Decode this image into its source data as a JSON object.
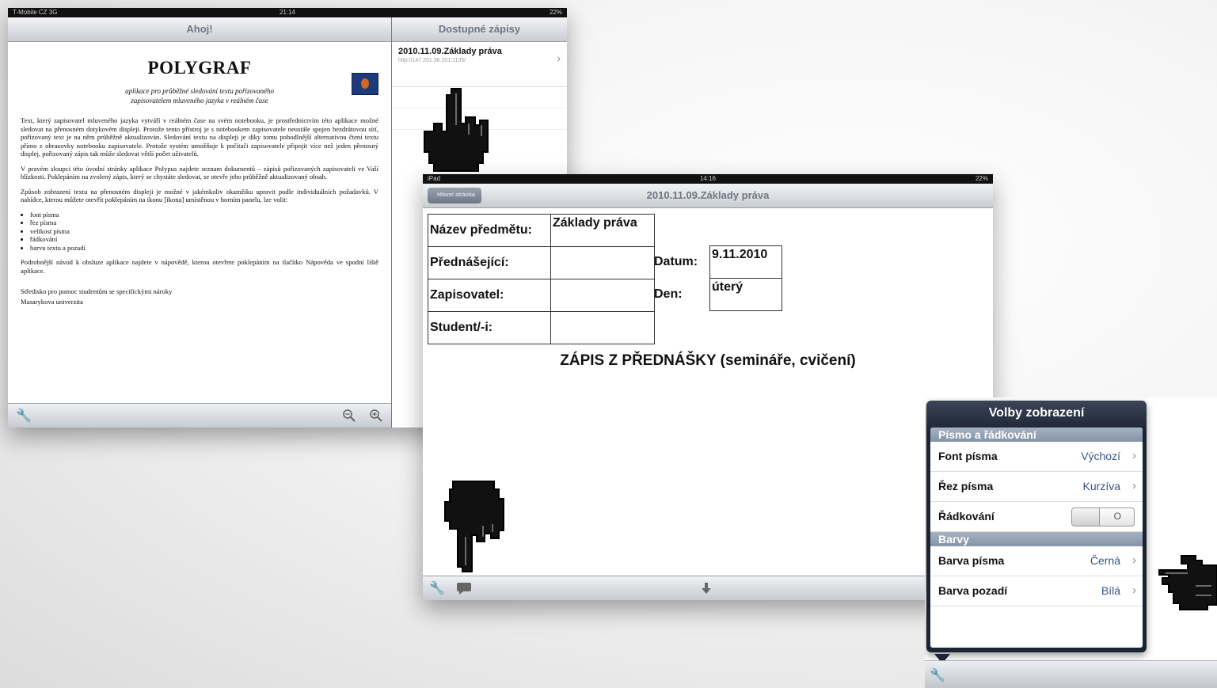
{
  "shot1": {
    "status": {
      "carrier": "T-Mobile CZ  3G",
      "time": "21:14",
      "battery": "22%"
    },
    "left_title": "Ahoj!",
    "right_title": "Dostupné zápisy",
    "doc": {
      "heading": "POLYGRAF",
      "subtitle_1": "aplikace pro průběžné sledování textu pořizovaného",
      "subtitle_2": "zapisovatelem mluveného jazyka v reálném čase",
      "p1": "Text, který zapisovatel mluveného jazyka vytváří v reálném čase na svém notebooku, je prostřednictvím této aplikace možné sledovat na přenosném dotykovém displeji. Protože tento přístroj je s notebookem zapisovatele neustále spojen bezdrátovou sítí, pořizovaný text je na něm průběžně aktualizován. Sledování textu na displeji je díky tomu pohodlnější alternativou čtení textu přímo z obrazovky notebooku zapisovatele. Protože systém umožňuje k počítači zapisovatele připojit více než jeden přenosný displej, pořizovaný zápis tak může sledovat větší počet uživatelů.",
      "p2": "V pravém sloupci této úvodní stránky aplikace Polypus najdete seznam dokumentů – zápisů pořizovaných zapisovateli ve Vaší blízkosti. Poklepáním na zvolený zápis, který se chystáte sledovat, se otevře jeho průběžně aktualizovaný obsah.",
      "p3": "Způsob zobrazení textu na přenosném displeji je možné v jakémkoliv okamžiku upravit podle individuálních požadavků. V nabídce, kterou můžete otevřít poklepáním na ikonu [ikona] umístěnou v horním panelu, lze volit:",
      "bullets": [
        "font písma",
        "řez písma",
        "velikost písma",
        "řádkování",
        "barvu textu a pozadí"
      ],
      "p4": "Podrobnější návod k obsluze aplikace najdete v nápovědě, kterou otevřete poklepáním na tlačítko Nápověda ve spodní liště aplikace.",
      "footer_1": "Středisko pro pomoc studentům se specifickými nároky",
      "footer_2": "Masarykova univerzita"
    },
    "list_item": {
      "title": "2010.11.09.Základy práva",
      "url": "http://147.251.36.201:1135/"
    }
  },
  "shot2": {
    "status": {
      "device": "iPad",
      "time": "14:16",
      "battery": "22%"
    },
    "back_label": "Hlavní stránka",
    "title": "2010.11.09.Základy práva",
    "form": {
      "predmet_label": "Název předmětu:",
      "predmet_value": "Základy práva",
      "prednasejici_label": "Přednášející:",
      "zapisovatel_label": "Zapisovatel:",
      "student_label": "Student/-i:",
      "datum_label": "Datum:",
      "datum_value": "9.11.2010",
      "den_label": "Den:",
      "den_value": "úterý"
    },
    "heading": "ZÁPIS Z PŘEDNÁŠKY (semináře, cvičení)"
  },
  "shot3": {
    "title": "Volby zobrazení",
    "section1": "Písmo a řádkování",
    "font_label": "Font písma",
    "font_value": "Výchozí",
    "rez_label": "Řez písma",
    "rez_value": "Kurzíva",
    "radkovani_label": "Řádkování",
    "toggle_off": "O",
    "section2": "Barvy",
    "barva_pisma_label": "Barva písma",
    "barva_pisma_value": "Černá",
    "barva_pozadi_label": "Barva pozadí",
    "barva_pozadi_value": "Bílá"
  },
  "icons": {
    "wrench": "wrench-icon",
    "zoom_out": "zoom-out-icon",
    "zoom_in": "zoom-in-icon",
    "chat": "chat-icon",
    "download": "download-icon",
    "hand": "pointing-hand-icon"
  }
}
